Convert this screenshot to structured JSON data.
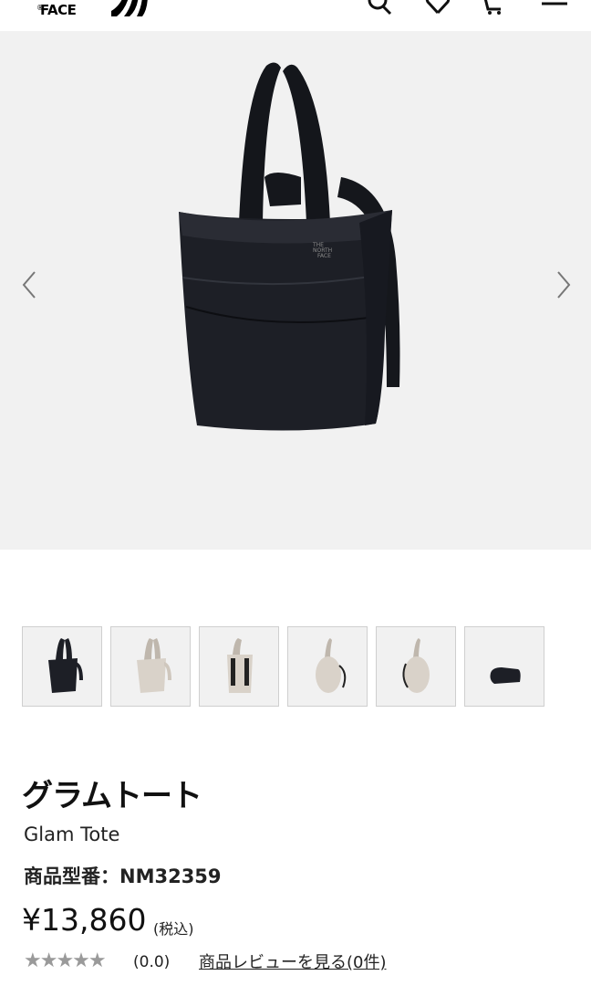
{
  "header": {
    "brand_name": "FACE",
    "brand_reg": "®",
    "icons": [
      "search-icon",
      "heart-icon",
      "cart-icon",
      "menu-icon"
    ]
  },
  "product": {
    "name_ja": "グラムトート",
    "name_en": "Glam Tote",
    "model_label": "商品型番：NM32359",
    "price": "¥13,860",
    "tax_note": "(税込)",
    "stars": "★★★★★",
    "rating_value": 0.0,
    "rating_text": "(0.0)",
    "review_link": "商品レビューを見る(0件)",
    "bag_logo": [
      "THE",
      "NORTH",
      "FACE"
    ]
  },
  "thumbnails": [
    {
      "label": "black-tote",
      "color": "#1d1f26"
    },
    {
      "label": "beige-tote",
      "color": "#d9d2c9"
    },
    {
      "label": "beige-backpack",
      "color": "#d9d2c9"
    },
    {
      "label": "beige-side",
      "color": "#d9d2c9"
    },
    {
      "label": "beige-side-strap",
      "color": "#d9d2c9"
    },
    {
      "label": "black-packed",
      "color": "#1d1f26"
    }
  ],
  "colors": {
    "page_bg": "#ffffff",
    "image_bg": "#f1f1f1",
    "bag_black": "#1d1f26",
    "bag_beige": "#d9d2c9",
    "star_gray": "#9a9a9a"
  }
}
